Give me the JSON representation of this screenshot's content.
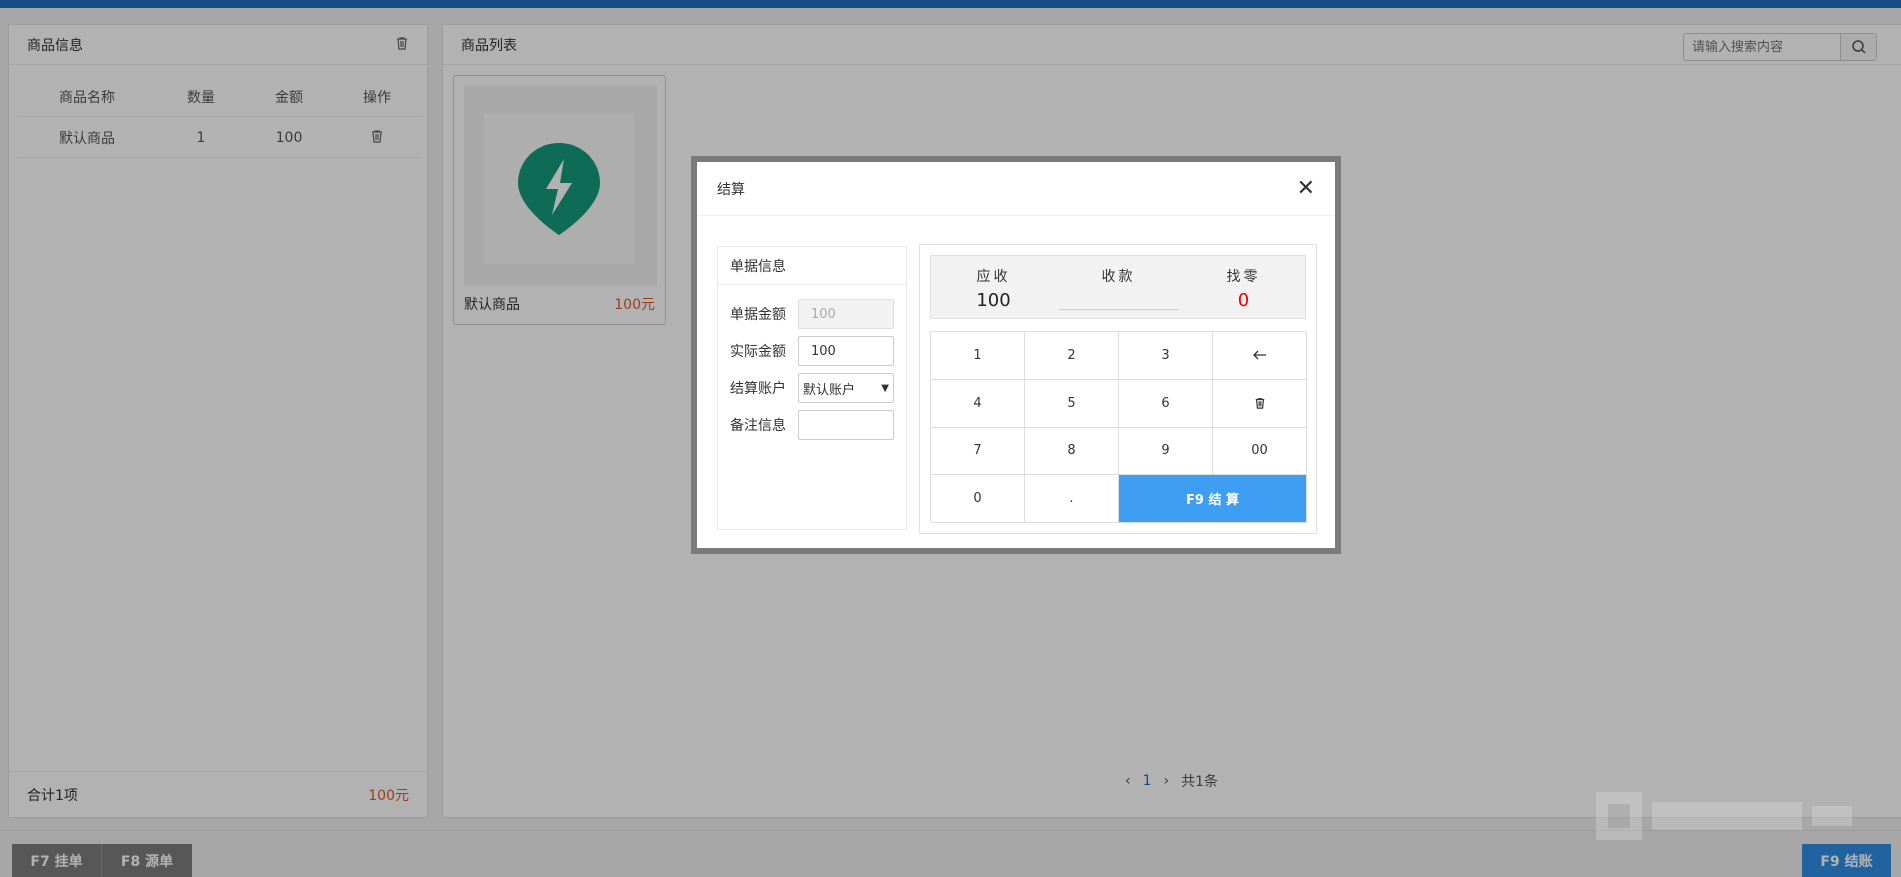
{
  "left_panel": {
    "title": "商品信息",
    "columns": [
      "商品名称",
      "数量",
      "金额",
      "操作"
    ],
    "rows": [
      {
        "name": "默认商品",
        "qty": "1",
        "amount": "100"
      }
    ],
    "footer": {
      "count_label": "合计1项",
      "total": "100元"
    }
  },
  "right_panel": {
    "title": "商品列表",
    "search_placeholder": "请输入搜索内容",
    "products": [
      {
        "name": "默认商品",
        "price": "100元"
      }
    ],
    "pager": {
      "current": "1",
      "total": "共1条"
    }
  },
  "bottom": {
    "f7": "F7 挂单",
    "f8": "F8 源单",
    "f9": "F9 结账"
  },
  "modal": {
    "title": "结算",
    "bill": {
      "title": "单据信息",
      "amount_label": "单据金额",
      "amount_value": "100",
      "actual_label": "实际金额",
      "actual_value": "100",
      "account_label": "结算账户",
      "account_value": "默认账户",
      "note_label": "备注信息",
      "note_value": ""
    },
    "summary": {
      "receivable_label": "应收",
      "receivable_value": "100",
      "received_label": "收款",
      "received_value": "",
      "change_label": "找零",
      "change_value": "0"
    },
    "keys": [
      "1",
      "2",
      "3",
      "←",
      "4",
      "5",
      "6",
      "🗑",
      "7",
      "8",
      "9",
      "00",
      "0",
      "."
    ],
    "settle_label": "F9 结 算"
  },
  "colors": {
    "accent": "#1e6fc1",
    "settle": "#3d9ef3",
    "price": "#e4572e",
    "change": "#ee0000",
    "brand_icon": "#149a7c"
  },
  "icons": [
    "trash-icon",
    "search-icon",
    "bolt-pin-icon",
    "close-icon",
    "backspace-icon"
  ]
}
